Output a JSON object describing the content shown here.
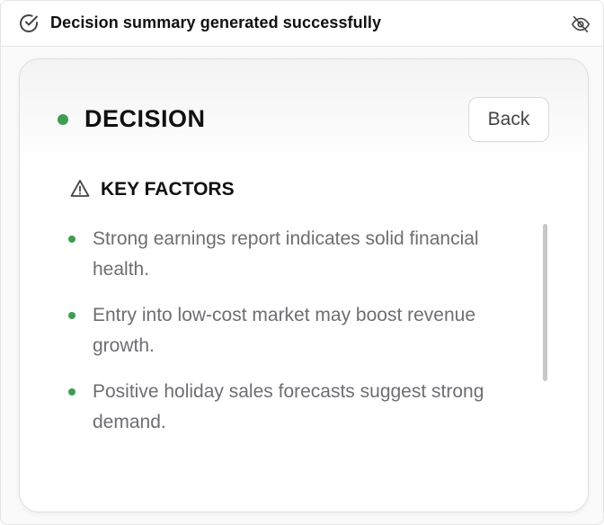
{
  "notification": {
    "message": "Decision summary generated successfully",
    "status_icon": "check-circle-icon",
    "hide_icon": "eye-off-icon"
  },
  "decision_card": {
    "title": "DECISION",
    "status_color": "#3f9d52",
    "back_label": "Back",
    "key_factors": {
      "heading": "KEY FACTORS",
      "icon": "warning-triangle-icon",
      "items": [
        "Strong earnings report indicates solid financial health.",
        "Entry into low-cost market may boost revenue growth.",
        "Positive holiday sales forecasts suggest strong demand."
      ]
    }
  }
}
